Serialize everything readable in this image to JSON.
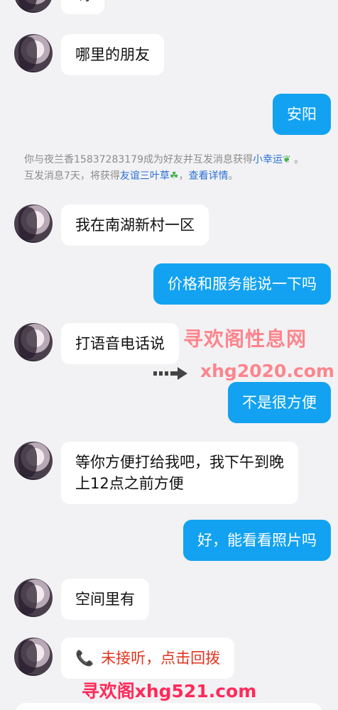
{
  "messages": [
    {
      "side": "in",
      "text": "嗎"
    },
    {
      "side": "in",
      "text": "哪里的朋友"
    },
    {
      "side": "out",
      "text": "安阳"
    },
    {
      "side": "in",
      "text": "我在南湖新村一区"
    },
    {
      "side": "out",
      "text": "价格和服务能说一下吗"
    },
    {
      "side": "in",
      "text": "打语音电话说"
    },
    {
      "side": "out",
      "text": "不是很方便"
    },
    {
      "side": "in",
      "text_line1": "等你方便打给我吧，我下午到晚",
      "text_line2": "上12点之前方便"
    },
    {
      "side": "out",
      "text": "好，能看看照片吗"
    },
    {
      "side": "in",
      "text": "空间里有"
    },
    {
      "side": "in",
      "call_icon": "phone-icon",
      "text": "未接听，点击回拨"
    }
  ],
  "system_notice": {
    "part1": "你与夜兰香15837283179成为好友并互发消息获得",
    "link1": "小幸运",
    "part2": "。",
    "part3": "互发消息7天，将获得",
    "link2": "友谊三叶草",
    "part4": "，",
    "link3": "查看详情",
    "part5": "。"
  },
  "watermarks": {
    "cn": "寻欢阁性息网",
    "url": "xhg2020.com",
    "bottom": "寻欢阁xhg521.com"
  },
  "colors": {
    "outgoing_bubble": "#12a2f1",
    "incoming_bubble": "#ffffff",
    "background": "#f2f2f4",
    "link": "#2b6fd6",
    "missed_call": "#e2331f"
  }
}
